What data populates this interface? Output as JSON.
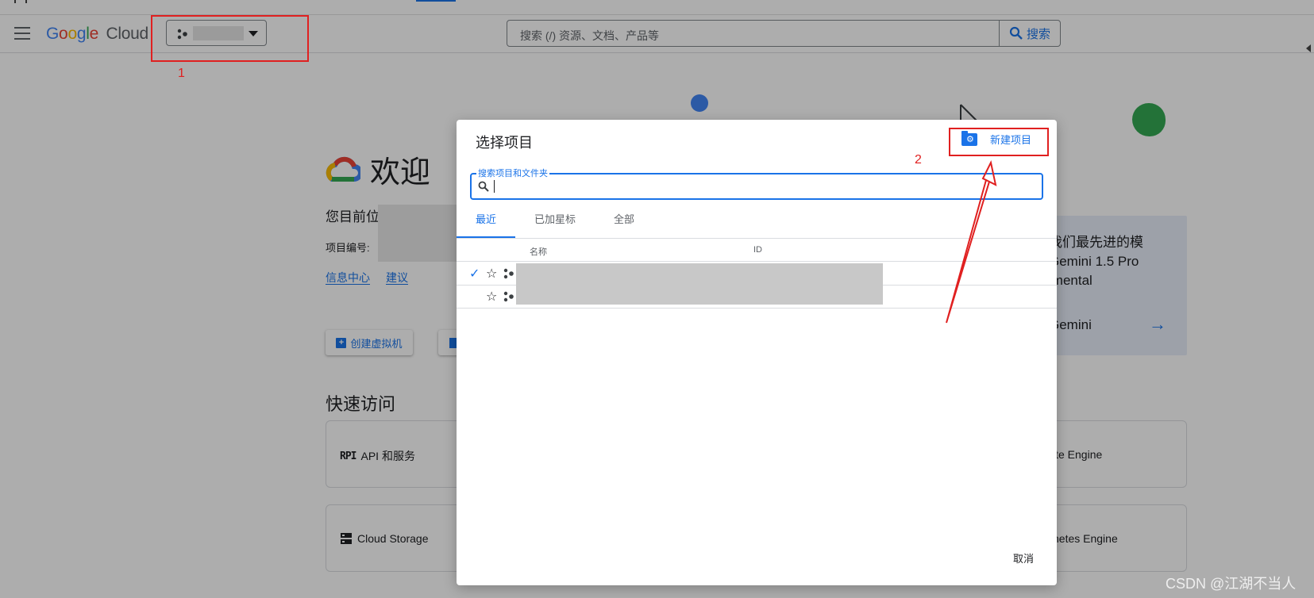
{
  "header": {
    "logo_google": "Google",
    "logo_cloud": "Cloud",
    "search_placeholder": "搜索 (/) 资源、文档、产品等",
    "search_button": "搜索"
  },
  "page": {
    "welcome": "欢迎",
    "current_project_label": "您目前位",
    "project_number_label": "项目编号:",
    "link_info": "信息中心",
    "link_suggest": "建议",
    "create_vm_button": "创建虚拟机",
    "quick_access_title": "快速访问",
    "qa_api": "API 和服务",
    "qa_storage": "Cloud Storage",
    "qa_compute": "ite Engine",
    "qa_kube": "netes Engine",
    "gemini_line1": "我们最先进的模",
    "gemini_line2": "Gemini 1.5 Pro",
    "gemini_line3": "imental",
    "gemini_cta": "Gemini"
  },
  "dialog": {
    "title": "选择项目",
    "new_project": "新建项目",
    "search_label": "搜索项目和文件夹",
    "tabs": [
      "最近",
      "已加星标",
      "全部"
    ],
    "columns": {
      "name": "名称",
      "id": "ID"
    },
    "cancel": "取消"
  },
  "annotations": {
    "one": "1",
    "two": "2"
  },
  "watermark": "CSDN @江湖不当人",
  "colors": {
    "accent": "#1a73e8",
    "annotation": "#e02020"
  }
}
